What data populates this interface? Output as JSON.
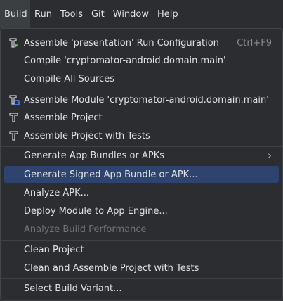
{
  "menubar": {
    "items": [
      {
        "label": "Build",
        "active": true
      },
      {
        "label": "Run"
      },
      {
        "label": "Tools"
      },
      {
        "label": "Git"
      },
      {
        "label": "Window"
      },
      {
        "label": "Help"
      }
    ]
  },
  "build_menu": {
    "items": [
      {
        "label": "Assemble 'presentation' Run Configuration",
        "shortcut": "Ctrl+F9",
        "icon": "run-config-build-icon"
      },
      {
        "label": "Compile 'cryptomator-android.domain.main'"
      },
      {
        "label": "Compile All Sources"
      },
      {
        "label": "Assemble Module 'cryptomator-android.domain.main'",
        "icon": "module-build-icon"
      },
      {
        "label": "Assemble Project",
        "icon": "hammer-icon"
      },
      {
        "label": "Assemble Project with Tests",
        "icon": "hammer-icon"
      },
      {
        "label": "Generate App Bundles or APKs",
        "submenu": true
      },
      {
        "label": "Generate Signed App Bundle or APK...",
        "selected": true
      },
      {
        "label": "Analyze APK..."
      },
      {
        "label": "Deploy Module to App Engine..."
      },
      {
        "label": "Analyze Build Performance",
        "disabled": true
      },
      {
        "label": "Clean Project"
      },
      {
        "label": "Clean and Assemble Project with Tests"
      },
      {
        "label": "Select Build Variant..."
      }
    ],
    "submenu_arrow": "›"
  },
  "colors": {
    "background": "#2b2d30",
    "selection": "#2e436e",
    "text": "#dfe1e5",
    "disabled_text": "#6f737a",
    "icon_green": "#5fb865",
    "icon_blue": "#548af7"
  }
}
